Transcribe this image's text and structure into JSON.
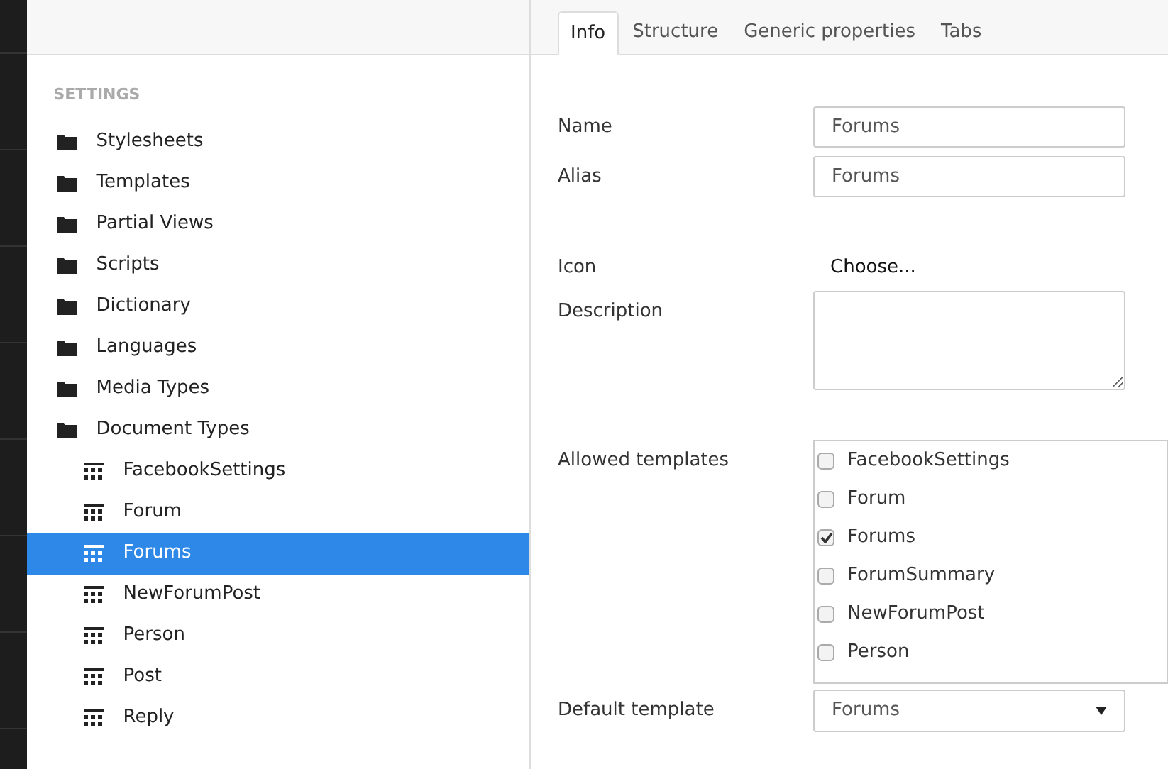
{
  "tree": {
    "heading": "SETTINGS",
    "items": [
      {
        "label": "Stylesheets",
        "kind": "folder",
        "selected": false
      },
      {
        "label": "Templates",
        "kind": "folder",
        "selected": false
      },
      {
        "label": "Partial Views",
        "kind": "folder",
        "selected": false
      },
      {
        "label": "Scripts",
        "kind": "folder",
        "selected": false
      },
      {
        "label": "Dictionary",
        "kind": "folder",
        "selected": false
      },
      {
        "label": "Languages",
        "kind": "folder",
        "selected": false
      },
      {
        "label": "Media Types",
        "kind": "folder",
        "selected": false
      },
      {
        "label": "Document Types",
        "kind": "folder",
        "selected": false,
        "children": [
          {
            "label": "FacebookSettings",
            "kind": "doctype",
            "selected": false
          },
          {
            "label": "Forum",
            "kind": "doctype",
            "selected": false
          },
          {
            "label": "Forums",
            "kind": "doctype",
            "selected": true
          },
          {
            "label": "NewForumPost",
            "kind": "doctype",
            "selected": false
          },
          {
            "label": "Person",
            "kind": "doctype",
            "selected": false
          },
          {
            "label": "Post",
            "kind": "doctype",
            "selected": false
          },
          {
            "label": "Reply",
            "kind": "doctype",
            "selected": false
          }
        ]
      }
    ]
  },
  "tabs": [
    {
      "label": "Info",
      "selected": true
    },
    {
      "label": "Structure",
      "selected": false
    },
    {
      "label": "Generic properties",
      "selected": false
    },
    {
      "label": "Tabs",
      "selected": false
    }
  ],
  "form": {
    "name": {
      "label": "Name",
      "value": "Forums"
    },
    "alias": {
      "label": "Alias",
      "value": "Forums"
    },
    "icon": {
      "label": "Icon",
      "action": "Choose..."
    },
    "description": {
      "label": "Description"
    },
    "allowed_templates": {
      "label": "Allowed templates",
      "options": [
        {
          "label": "FacebookSettings",
          "checked": false
        },
        {
          "label": "Forum",
          "checked": false
        },
        {
          "label": "Forums",
          "checked": true
        },
        {
          "label": "ForumSummary",
          "checked": false
        },
        {
          "label": "NewForumPost",
          "checked": false
        },
        {
          "label": "Person",
          "checked": false
        }
      ]
    },
    "default_template": {
      "label": "Default template",
      "value": "Forums"
    }
  }
}
